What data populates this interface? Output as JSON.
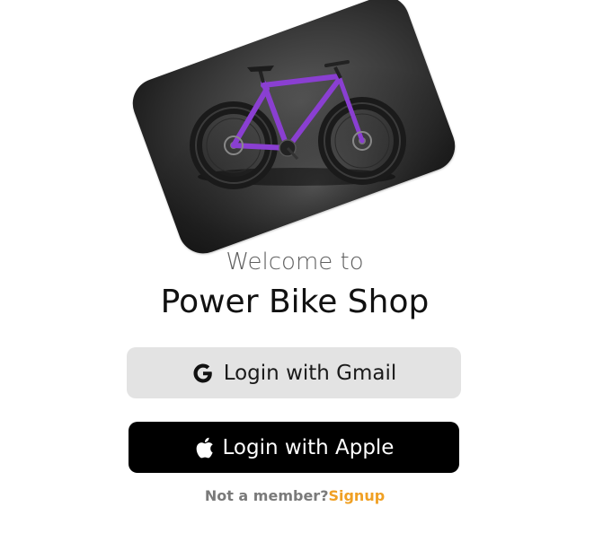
{
  "hero": {
    "image_alt": "purple fat bike on dark background"
  },
  "welcome_text": "Welcome to",
  "shop_name": "Power Bike Shop",
  "buttons": {
    "gmail": {
      "label": "Login with Gmail",
      "icon": "google-g-icon"
    },
    "apple": {
      "label": "Login with Apple",
      "icon": "apple-icon"
    }
  },
  "signup": {
    "prompt": "Not a member?",
    "link": "Signup"
  },
  "colors": {
    "bike_frame": "#8a3fd1",
    "signup_link": "#f0a024",
    "gmail_button_bg": "#e3e3e3",
    "apple_button_bg": "#000000"
  }
}
